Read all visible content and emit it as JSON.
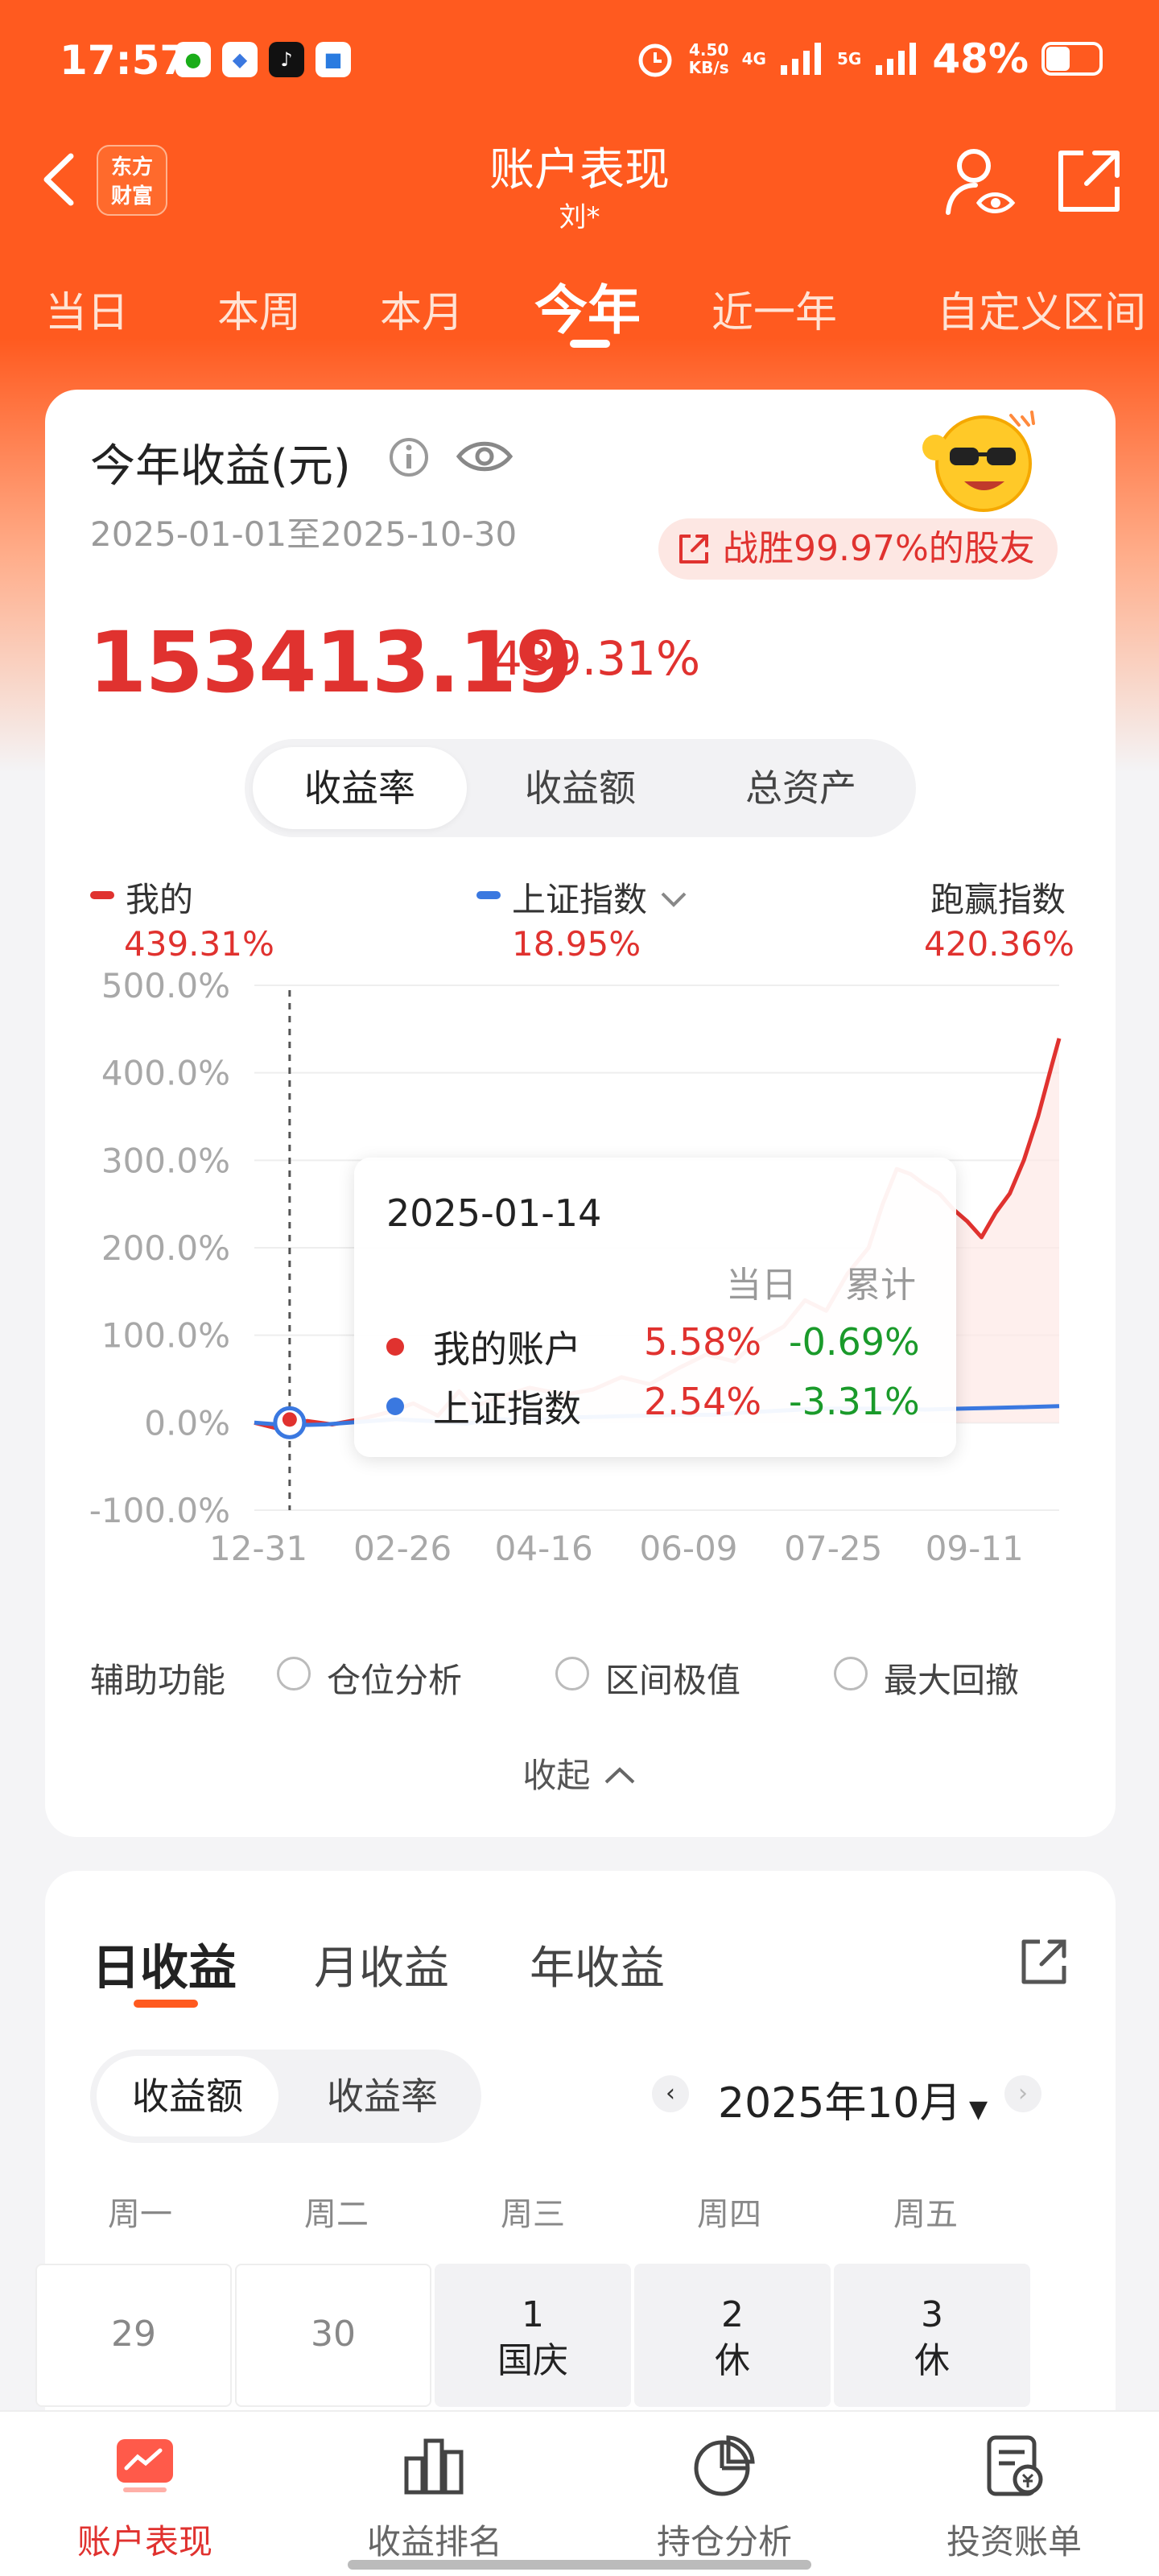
{
  "status_bar": {
    "time": "17:57",
    "net_speed_value": "4.50",
    "net_speed_unit": "KB/s",
    "net1": "4G",
    "net2": "5G",
    "battery": "48%",
    "battery_level": 0.48
  },
  "nav": {
    "logo_line1": "东方",
    "logo_line2": "财富",
    "title": "账户表现",
    "subtitle": "刘*"
  },
  "period_tabs": [
    "当日",
    "本周",
    "本月",
    "今年",
    "近一年",
    "自定义区间"
  ],
  "period_active": "今年",
  "summary": {
    "title": "今年收益(元)",
    "date_range": "2025-01-01至2025-10-30",
    "beat_text": "战胜99.97%的股友",
    "value": "153413.19",
    "percent": "439.31%"
  },
  "metric_tabs": [
    "收益率",
    "收益额",
    "总资产"
  ],
  "legend": {
    "mine_label": "我的",
    "mine_value": "439.31%",
    "index_label": "上证指数",
    "index_value": "18.95%",
    "outperform_label": "跑赢指数",
    "outperform_value": "420.36%"
  },
  "chart_data": {
    "type": "line",
    "x_ticks": [
      "12-31",
      "02-26",
      "04-16",
      "06-09",
      "07-25",
      "09-11"
    ],
    "y_ticks": [
      "500.0%",
      "400.0%",
      "300.0%",
      "200.0%",
      "100.0%",
      "0.0%",
      "-100.0%"
    ],
    "ylim": [
      -100,
      500
    ],
    "grid": true,
    "colors": {
      "mine": "#e0322f",
      "index": "#3a78e0"
    },
    "series": [
      {
        "name": "我的",
        "points": [
          [
            0,
            0
          ],
          [
            6,
            -6
          ],
          [
            10,
            -3
          ],
          [
            15,
            2
          ],
          [
            22,
            -2
          ],
          [
            30,
            4
          ],
          [
            38,
            12
          ],
          [
            45,
            22
          ],
          [
            52,
            8
          ],
          [
            58,
            36
          ],
          [
            62,
            18
          ],
          [
            70,
            30
          ],
          [
            78,
            40
          ],
          [
            88,
            32
          ],
          [
            96,
            38
          ],
          [
            104,
            52
          ],
          [
            112,
            44
          ],
          [
            120,
            62
          ],
          [
            128,
            78
          ],
          [
            136,
            70
          ],
          [
            142,
            92
          ],
          [
            150,
            110
          ],
          [
            156,
            140
          ],
          [
            162,
            128
          ],
          [
            168,
            170
          ],
          [
            174,
            200
          ],
          [
            178,
            250
          ],
          [
            182,
            290
          ],
          [
            186,
            284
          ],
          [
            190,
            272
          ],
          [
            194,
            262
          ],
          [
            198,
            244
          ],
          [
            202,
            230
          ],
          [
            206,
            212
          ],
          [
            210,
            240
          ],
          [
            214,
            262
          ],
          [
            218,
            300
          ],
          [
            222,
            350
          ],
          [
            226,
            410
          ],
          [
            228,
            439.31
          ]
        ]
      },
      {
        "name": "上证指数",
        "points": [
          [
            0,
            0
          ],
          [
            10,
            -3
          ],
          [
            20,
            -2
          ],
          [
            30,
            1
          ],
          [
            40,
            4
          ],
          [
            50,
            2
          ],
          [
            60,
            -1
          ],
          [
            70,
            4
          ],
          [
            80,
            3
          ],
          [
            90,
            6
          ],
          [
            100,
            7
          ],
          [
            110,
            8
          ],
          [
            120,
            9
          ],
          [
            130,
            9
          ],
          [
            140,
            12
          ],
          [
            150,
            14
          ],
          [
            160,
            16
          ],
          [
            170,
            16
          ],
          [
            180,
            16
          ],
          [
            190,
            15
          ],
          [
            200,
            16
          ],
          [
            210,
            17
          ],
          [
            220,
            18
          ],
          [
            228,
            18.95
          ]
        ]
      }
    ]
  },
  "tooltip": {
    "date": "2025-01-14",
    "col_today": "当日",
    "col_total": "累计",
    "mine_label": "我的账户",
    "mine_today": "5.58%",
    "mine_total": "-0.69%",
    "index_label": "上证指数",
    "index_today": "2.54%",
    "index_total": "-3.31%"
  },
  "aux": {
    "label": "辅助功能",
    "options": [
      "仓位分析",
      "区间极值",
      "最大回撤"
    ]
  },
  "collapse_label": "收起",
  "earnings": {
    "tabs": [
      "日收益",
      "月收益",
      "年收益"
    ],
    "metric_tabs": [
      "收益额",
      "收益率"
    ],
    "month": "2025年10月",
    "weekdays": [
      "周一",
      "周二",
      "周三",
      "周四",
      "周五"
    ],
    "days": [
      {
        "num": "29",
        "note": ""
      },
      {
        "num": "30",
        "note": ""
      },
      {
        "num": "1",
        "note": "国庆"
      },
      {
        "num": "2",
        "note": "休"
      },
      {
        "num": "3",
        "note": "休"
      }
    ]
  },
  "bottom_nav": [
    "账户表现",
    "收益排名",
    "持仓分析",
    "投资账单"
  ]
}
